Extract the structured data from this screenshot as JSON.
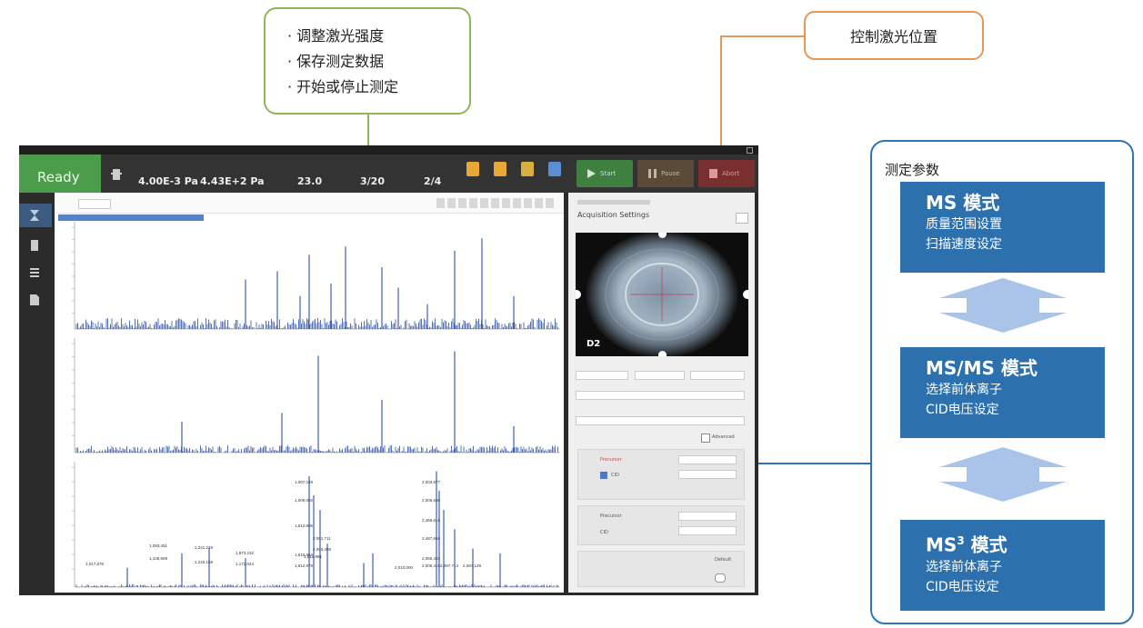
{
  "callouts": {
    "laser_tasks": [
      "· 调整激光强度",
      "· 保存测定数据",
      "· 开始或停止测定"
    ],
    "laser_position": "控制激光位置"
  },
  "params": {
    "title": "测定参数",
    "modes": [
      {
        "title": "MS 模式",
        "lines": [
          "质量范围设置",
          "扫描速度设定"
        ]
      },
      {
        "title": "MS/MS 模式",
        "lines": [
          "选择前体离子",
          "CID电压设定"
        ]
      },
      {
        "title_base": "MS",
        "title_sup": "3",
        "title_rest": " 模式",
        "lines": [
          "选择前体离子",
          "CID电压设定"
        ]
      }
    ]
  },
  "app": {
    "status": "Ready",
    "pressure_1": "4.00E-3 Pa",
    "pressure_2": "4.43E+2 Pa",
    "value_1": "23.0",
    "progress": "3/20",
    "counter": "2/4",
    "start_label": "Start",
    "pause_label": "Pause",
    "abort_label": "Abort",
    "laser_view_label": "D2",
    "panel_title": "Acquisition Settings",
    "advanced_label": "Advanced",
    "precursor_label": "Precursor",
    "cid_label": "CID",
    "default_label": "Default"
  },
  "colors": {
    "callout_green": "#8db65b",
    "callout_orange": "#e79758",
    "params_blue": "#2e75b6",
    "mode_blue": "#2d70ae",
    "arrow_blue": "#a9c4e8",
    "spectrum_blue": "#2c52a8",
    "ready_green": "#4c9c4c"
  },
  "spectra": {
    "peak_labels": [
      "1,007.249",
      "2,003.877",
      "1,009,002",
      "2,005,636",
      "2,466,616",
      "1,612.896",
      "2,487,666",
      "2,061,711",
      "1,093,451",
      "1,241.248",
      "2,003,488",
      "1,873,232",
      "1,610,854",
      "1,108,609",
      "1,612.891",
      "2,065,433",
      "1,017,876",
      "1,240,158",
      "1,172,044",
      "1,612,978",
      "2,006,415",
      "2,497,714",
      "2,087,128",
      "2,010,000"
    ]
  }
}
